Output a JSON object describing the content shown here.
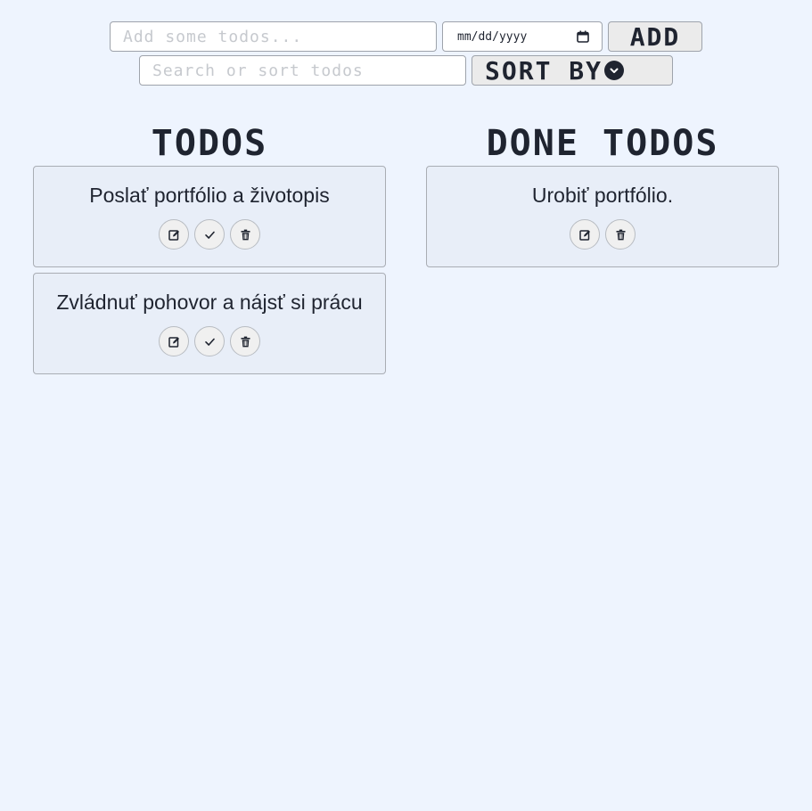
{
  "controls": {
    "add_placeholder": "Add some todos...",
    "date_placeholder": "mm/dd/yyyy",
    "add_label": "ADD",
    "search_placeholder": "Search or sort todos",
    "sort_label": "SORT BY"
  },
  "todos": {
    "heading": "TODOS",
    "items": [
      {
        "text": "Poslať portfólio a životopis",
        "actions": [
          "edit-icon",
          "check-icon",
          "trash-icon"
        ]
      },
      {
        "text": "Zvládnuť pohovor a nájsť si prácu",
        "actions": [
          "edit-icon",
          "check-icon",
          "trash-icon"
        ]
      }
    ]
  },
  "done": {
    "heading": "DONE TODOS",
    "items": [
      {
        "text": "Urobiť portfólio.",
        "actions": [
          "edit-icon",
          "trash-icon"
        ]
      }
    ]
  },
  "colors": {
    "background": "#eef4fe",
    "card": "#e8eef8",
    "text": "#1f2430",
    "button": "#ebebeb"
  }
}
